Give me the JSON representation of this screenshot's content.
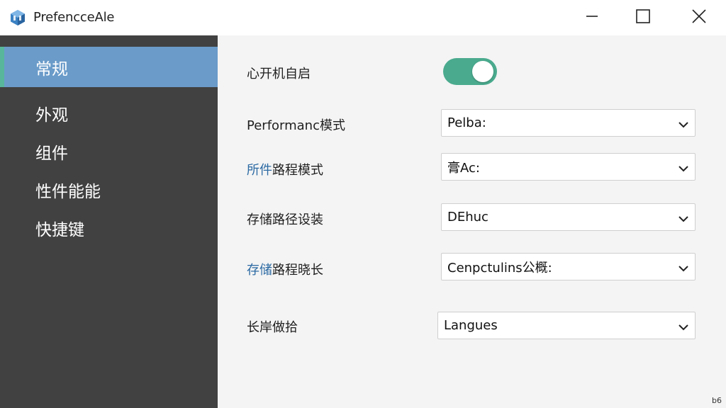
{
  "window": {
    "title": "PrefencceAle",
    "controls": {
      "minimize": "minimize-icon",
      "maximize": "maximize-icon",
      "close": "close-icon"
    }
  },
  "sidebar": {
    "items": [
      {
        "label": "常规",
        "active": true
      },
      {
        "label": "外观",
        "active": false
      },
      {
        "label": "组件",
        "active": false
      },
      {
        "label": "性件能能",
        "active": false
      },
      {
        "label": "快捷键",
        "active": false
      }
    ]
  },
  "settings": {
    "autostart": {
      "label": "心开机自启",
      "enabled": true
    },
    "performance": {
      "label": "Performanc模式",
      "value": "Pelba:"
    },
    "path_mode": {
      "label_accent": "所件",
      "label_rest": "路程模式",
      "value": "膏Ac:"
    },
    "storage_path": {
      "label": "存储路径设装",
      "value": "DEhuc"
    },
    "storage_duration": {
      "label_accent": "存储",
      "label_rest": "路程晓长",
      "value": "Cenpctulins公概:"
    },
    "language": {
      "label": "长岸做拾",
      "value": "Langues"
    }
  },
  "footer": {
    "corner_text": "b6"
  },
  "colors": {
    "sidebar_bg": "#414141",
    "sidebar_active": "#6a9bc9",
    "sidebar_active_edge": "#58b79b",
    "toggle_on": "#4aaa8d",
    "accent_text": "#2c6aa3"
  }
}
